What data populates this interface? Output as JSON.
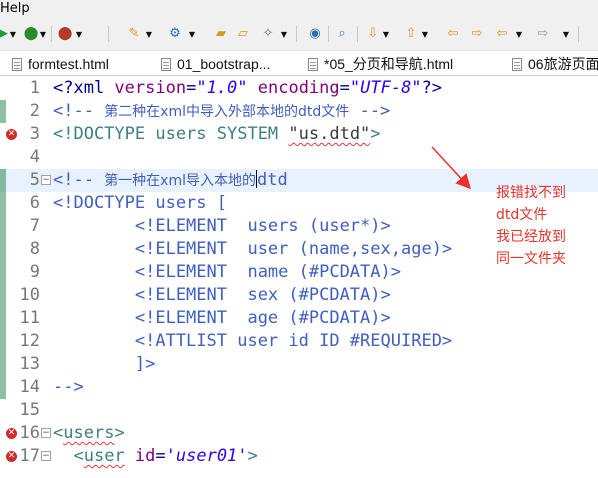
{
  "menubar": {
    "help_label": "Help"
  },
  "toolbar": {
    "buttons": [
      "run-icon",
      "debug-icon",
      "run-external-icon",
      "new-wizard-icon",
      "web-service-icon",
      "open-folder-icon",
      "open-file-icon",
      "tools-icon",
      "globe-icon",
      "search-icon",
      "down-arrow-icon",
      "up-arrow-icon",
      "prev-annotation-icon",
      "next-annotation-icon",
      "back-icon",
      "forward-icon"
    ]
  },
  "tabs": [
    {
      "label": "formtest.html"
    },
    {
      "label": "01_bootstrap..."
    },
    {
      "label": "*05_分页和导航.html"
    },
    {
      "label": "06旅游页面"
    }
  ],
  "editor": {
    "lines": [
      {
        "num": "1"
      },
      {
        "num": "2"
      },
      {
        "num": "3"
      },
      {
        "num": "4"
      },
      {
        "num": "5"
      },
      {
        "num": "6"
      },
      {
        "num": "7"
      },
      {
        "num": "8"
      },
      {
        "num": "9"
      },
      {
        "num": "10"
      },
      {
        "num": "11"
      },
      {
        "num": "12"
      },
      {
        "num": "13"
      },
      {
        "num": "14"
      },
      {
        "num": "15"
      },
      {
        "num": "16"
      },
      {
        "num": "17"
      }
    ],
    "code": {
      "l1_open": "<?xml ",
      "l1_attr1": "version",
      "l1_eq1": "=",
      "l1_val1": "\"1.0\"",
      "l1_attr2": " encoding",
      "l1_eq2": "=",
      "l1_val2": "\"UTF-8\"",
      "l1_close": "?>",
      "l2_open": "<!-- ",
      "l2_text": "第二种在xml中导入外部本地的dtd文件",
      "l2_close": " -->",
      "l3_decl": "<!DOCTYPE users SYSTEM ",
      "l3_str": "\"us.dtd\"",
      "l3_close": ">",
      "l5_open": "<!-- ",
      "l5_text": "第一种在xml导入本地的",
      "l5_tail": "dtd",
      "l6": "<!DOCTYPE users [",
      "l7": "        <!ELEMENT  users (user*)>",
      "l8": "        <!ELEMENT  user (name,sex,age)>",
      "l9": "        <!ELEMENT  name (#PCDATA)>",
      "l10": "        <!ELEMENT  sex (#PCDATA)>",
      "l11": "        <!ELEMENT  age (#PCDATA)>",
      "l12": "        <!ATTLIST user id ID #REQUIRED>",
      "l13": "        ]>",
      "l14": "-->",
      "l16_open": "<",
      "l16_tag": "users",
      "l16_close": ">",
      "l17_indent": "  <",
      "l17_tag": "user",
      "l17_attr": " id",
      "l17_eq": "=",
      "l17_val": "'user01'",
      "l17_close": ">"
    }
  },
  "annotation": {
    "lines": [
      "报错找不到",
      "dtd文件",
      "我已经放到",
      "同一文件夹"
    ],
    "color": "#e8332a"
  },
  "colors": {
    "comment": "#3f5fbf",
    "tag": "#3f7f7f",
    "attribute": "#7f007f",
    "value": "#2a00ff",
    "error_marker": "#d12b2b",
    "current_line": "#e8f2fe"
  }
}
